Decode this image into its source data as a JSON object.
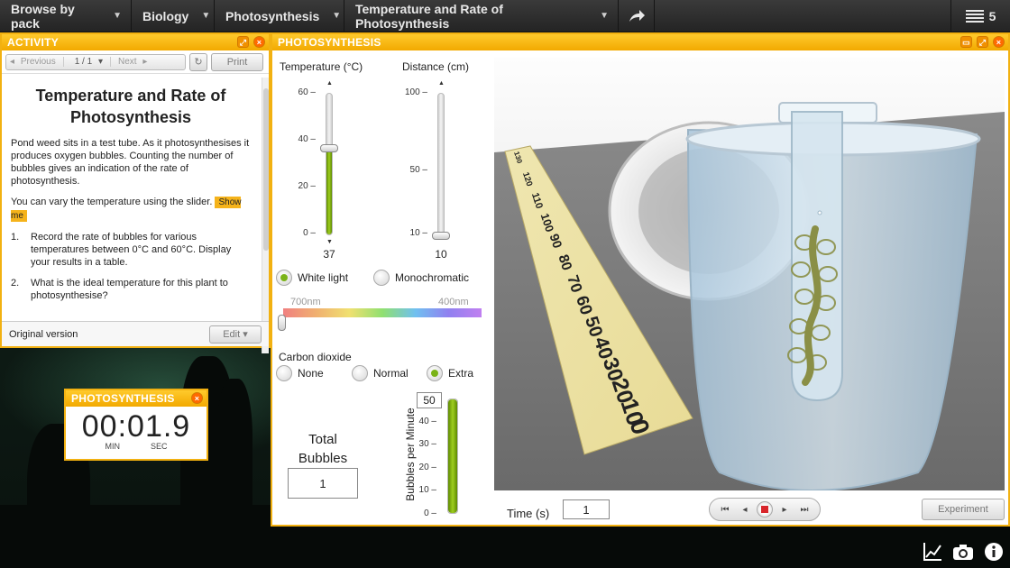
{
  "nav": {
    "crumbs": [
      "Browse by pack",
      "Biology",
      "Photosynthesis",
      "Temperature and Rate of Photosynthesis"
    ],
    "share_icon": "share-arrow-icon",
    "menu_count": "5"
  },
  "activity": {
    "title": "ACTIVITY",
    "prev": "Previous",
    "page": "1 / 1",
    "next": "Next",
    "print": "Print",
    "heading": "Temperature and Rate of Photosynthesis",
    "para1": "Pond weed sits in a test tube. As it photosynthesises it produces oxygen bubbles. Counting the number of bubbles gives an indication of the rate of photosynthesis.",
    "para2": "You can vary the temperature using the slider.",
    "show_me": "Show me",
    "steps": [
      {
        "n": "1.",
        "text": "Record the rate of bubbles for various temperatures between 0°C and 60°C. Display your results in a table."
      },
      {
        "n": "2.",
        "text": "What is the ideal temperature for this plant to photosynthesise?"
      }
    ],
    "footer_label": "Original version",
    "edit": "Edit"
  },
  "timer": {
    "title": "PHOTOSYNTHESIS",
    "digits": "00:01.9",
    "min": "MIN",
    "sec": "SEC"
  },
  "sim": {
    "title": "PHOTOSYNTHESIS",
    "temp_label": "Temperature (°C)",
    "temp_ticks": [
      "60",
      "40",
      "20",
      "0"
    ],
    "temp_value": "37",
    "temp_fraction": 0.617,
    "dist_label": "Distance (cm)",
    "dist_ticks": [
      "100",
      "50",
      "10"
    ],
    "dist_value": "10",
    "dist_fraction": 0.0,
    "light": {
      "white": "White light",
      "mono": "Monochromatic",
      "selected": "white"
    },
    "nm_left": "700nm",
    "nm_right": "400nm",
    "co2": {
      "label": "Carbon dioxide",
      "none": "None",
      "normal": "Normal",
      "extra": "Extra",
      "selected": "extra"
    },
    "total_label": "Total Bubbles",
    "total_value": "1",
    "bpm_label": "Bubbles per Minute",
    "bpm_value": "50",
    "bpm_ticks": [
      "40",
      "30",
      "20",
      "10",
      "0"
    ],
    "bpm_fraction": 1.0,
    "time_label": "Time (s)",
    "time_value": "1",
    "ruler_marks": [
      "0",
      "10",
      "20",
      "30",
      "40",
      "50",
      "60",
      "70",
      "80",
      "90",
      "100",
      "110",
      "120",
      "130"
    ],
    "experiment": "Experiment"
  },
  "colors": {
    "accent": "#f2b111",
    "slider_green": "#7ab317",
    "stop_red": "#d8252b"
  }
}
